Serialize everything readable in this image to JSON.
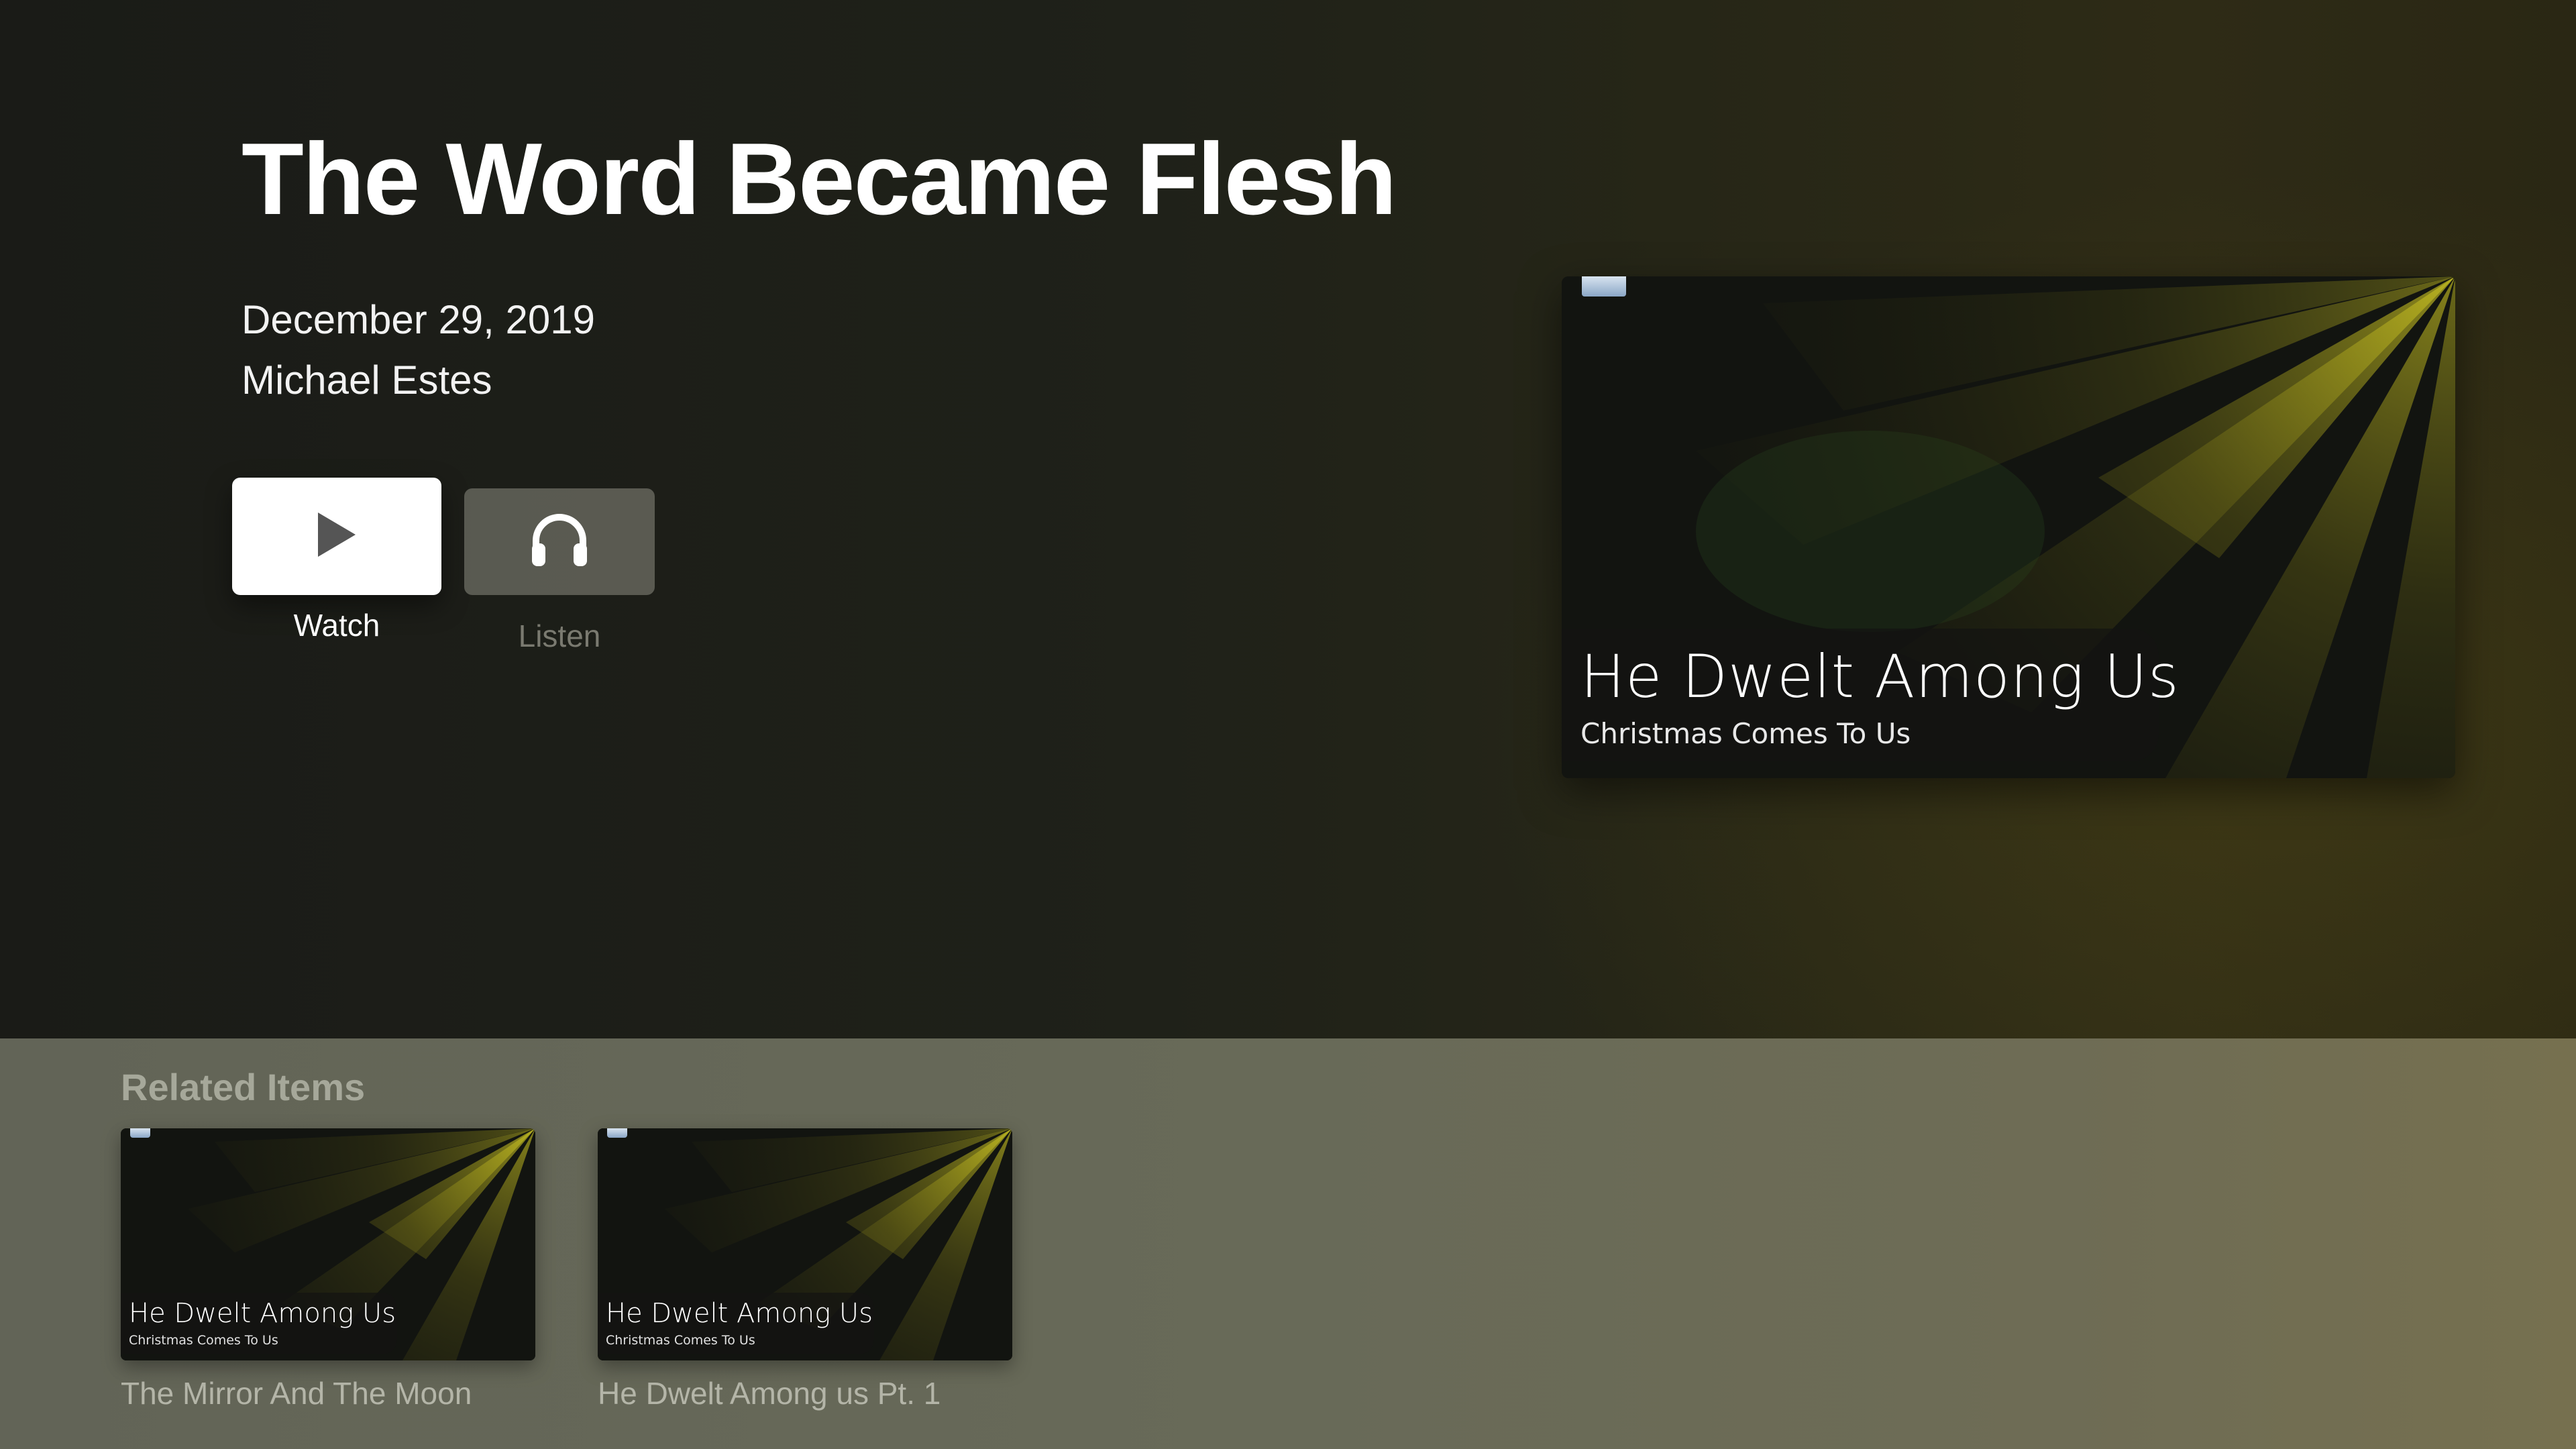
{
  "header": {
    "title": "The Word Became Flesh",
    "date": "December 29, 2019",
    "speaker": "Michael Estes"
  },
  "actions": {
    "watch": {
      "label": "Watch",
      "icon": "play-icon"
    },
    "listen": {
      "label": "Listen",
      "icon": "headphones-icon"
    }
  },
  "artwork": {
    "title": "He Dwelt Among Us",
    "subtitle": "Christmas Comes To Us"
  },
  "related": {
    "heading": "Related Items",
    "items": [
      {
        "title": "The Mirror And The Moon",
        "art_title": "He Dwelt Among Us",
        "art_subtitle": "Christmas Comes To Us"
      },
      {
        "title": "He Dwelt Among us Pt. 1",
        "art_title": "He Dwelt Among Us",
        "art_subtitle": "Christmas Comes To Us"
      }
    ]
  },
  "colors": {
    "background": "#1e2019",
    "related_background": "#686a58",
    "light_rays": "#c8c020",
    "button_focused": "#ffffff"
  }
}
